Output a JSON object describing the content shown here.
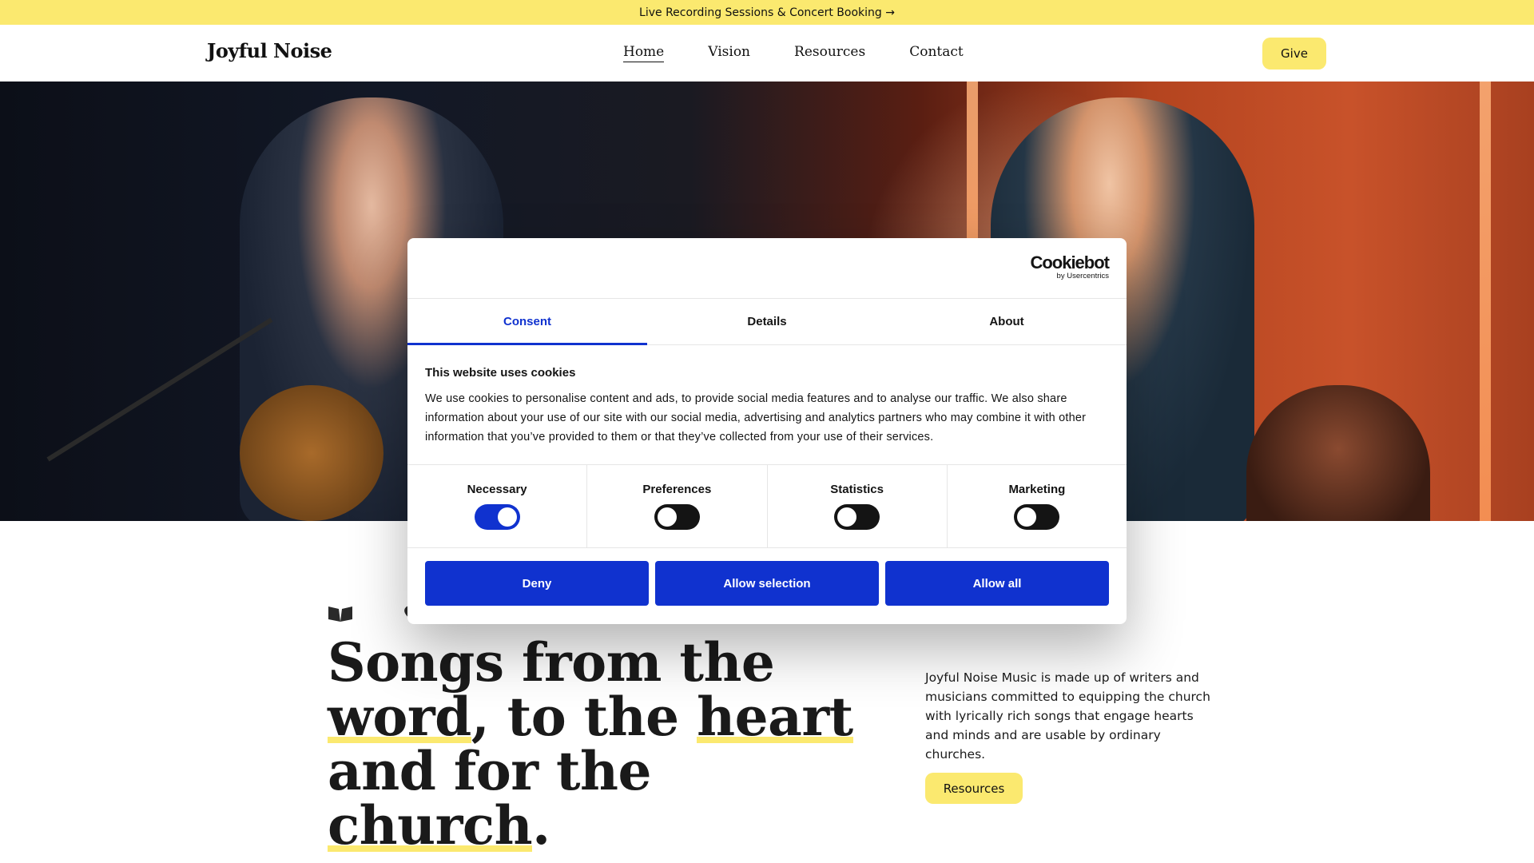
{
  "announcement": {
    "text": "Live Recording Sessions & Concert Booking →"
  },
  "header": {
    "logo": "Joyful Noise",
    "nav": [
      {
        "label": "Home",
        "active": true
      },
      {
        "label": "Vision"
      },
      {
        "label": "Resources"
      },
      {
        "label": "Contact"
      }
    ],
    "give_label": "Give"
  },
  "hero": {
    "image": "worship-band-performance-photo"
  },
  "content": {
    "headline": {
      "line1": "Songs from the",
      "word": "word",
      "mid": ", to the ",
      "heart": "heart",
      "line3_pre": "and for the ",
      "church": "church",
      "line3_post": "."
    },
    "intro": "Joyful Noise Music is made up of writers and musicians committed to equipping the church with lyrically rich songs that engage hearts and minds and are usable by ordinary churches.",
    "resources_label": "Resources"
  },
  "cookie_dialog": {
    "brand": "Cookiebot",
    "brand_sub": "by Usercentrics",
    "tabs": [
      "Consent",
      "Details",
      "About"
    ],
    "active_tab": "Consent",
    "title": "This website uses cookies",
    "body": "We use cookies to personalise content and ads, to provide social media features and to analyse our traffic. We also share information about your use of our site with our social media, advertising and analytics partners who may combine it with other information that you’ve provided to them or that they’ve collected from your use of their services.",
    "toggles": [
      {
        "label": "Necessary",
        "on": true
      },
      {
        "label": "Preferences",
        "on": false
      },
      {
        "label": "Statistics",
        "on": false
      },
      {
        "label": "Marketing",
        "on": false
      }
    ],
    "buttons": {
      "deny": "Deny",
      "allow_selection": "Allow selection",
      "allow_all": "Allow all"
    }
  },
  "colors": {
    "accent_yellow": "#fbe96f",
    "cookiebot_blue": "#1032cf",
    "text": "#1a1a1a"
  }
}
